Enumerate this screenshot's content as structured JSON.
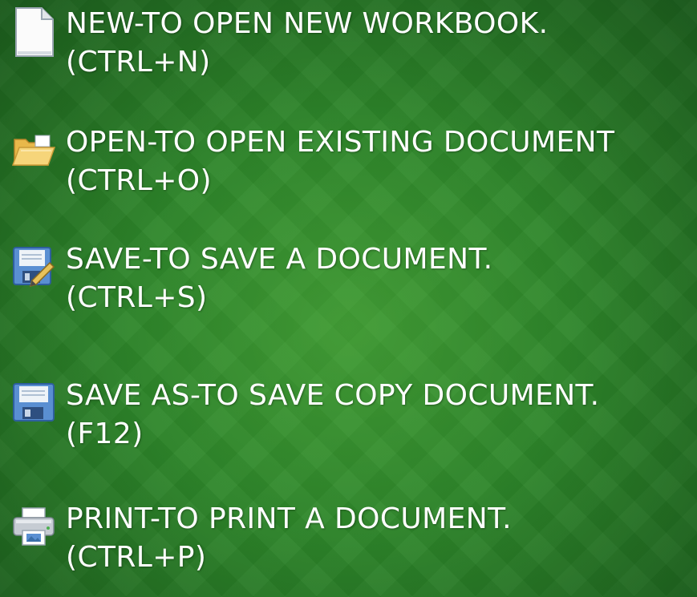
{
  "items": [
    {
      "icon": "new-document-icon",
      "line1": "NEW-TO OPEN NEW WORKBOOK.",
      "line2": "(CTRL+N)"
    },
    {
      "icon": "open-folder-icon",
      "line1": "OPEN-TO OPEN EXISTING DOCUMENT",
      "line2": "(CTRL+O)"
    },
    {
      "icon": "save-icon",
      "line1": "SAVE-TO SAVE A DOCUMENT.",
      "line2": "(CTRL+S)"
    },
    {
      "icon": "save-as-icon",
      "line1": "SAVE AS-TO SAVE COPY DOCUMENT.",
      "line2": "(F12)"
    },
    {
      "icon": "printer-icon",
      "line1": "PRINT-TO PRINT A DOCUMENT.",
      "line2": "(CTRL+P)"
    }
  ],
  "colors": {
    "background": "#2f8a2c",
    "text": "#ffffff"
  }
}
